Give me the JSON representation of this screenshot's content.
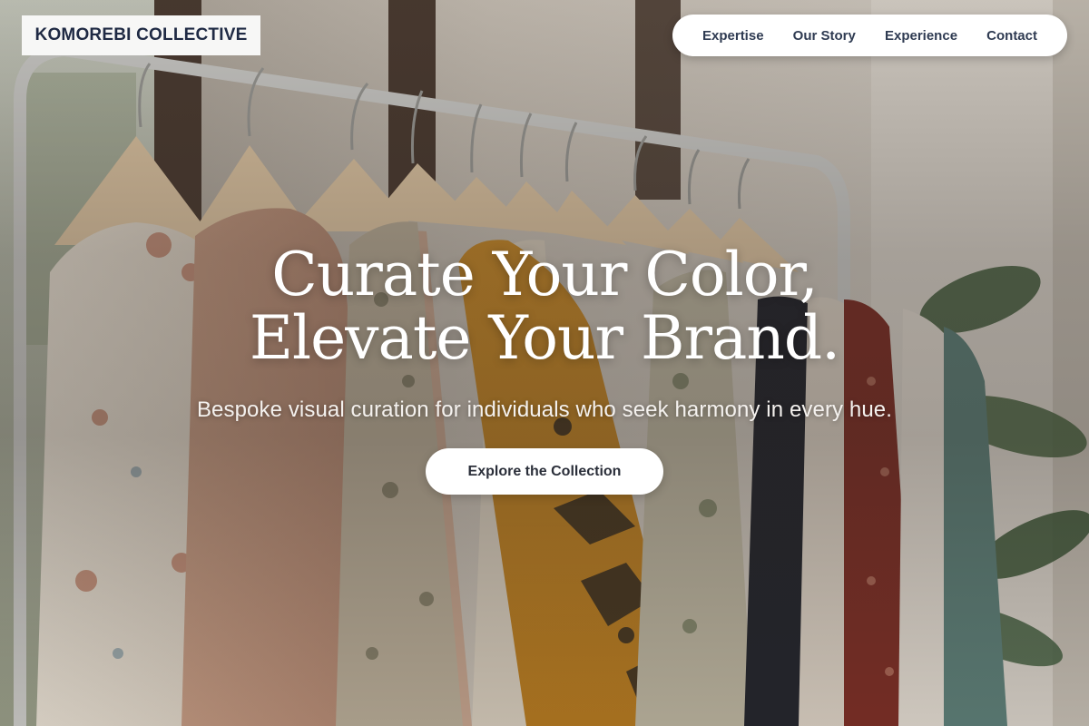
{
  "brand": {
    "logo_text": "KOMOREBI COLLECTIVE"
  },
  "nav": {
    "items": [
      {
        "label": "Expertise"
      },
      {
        "label": "Our Story"
      },
      {
        "label": "Experience"
      },
      {
        "label": "Contact"
      }
    ]
  },
  "hero": {
    "headline_line1": "Curate Your Color,",
    "headline_line2": "Elevate Your Brand.",
    "subheadline": "Bespoke visual curation for individuals who seek harmony in every hue.",
    "cta_label": "Explore the Collection",
    "background_image": "clothing-rack-photo"
  },
  "colors": {
    "logo_text": "#1f2a44",
    "nav_text": "#2f3b52",
    "nav_bg": "#ffffff",
    "headline": "#ffffff",
    "cta_bg": "#ffffff",
    "cta_text": "#2b2f3a"
  }
}
